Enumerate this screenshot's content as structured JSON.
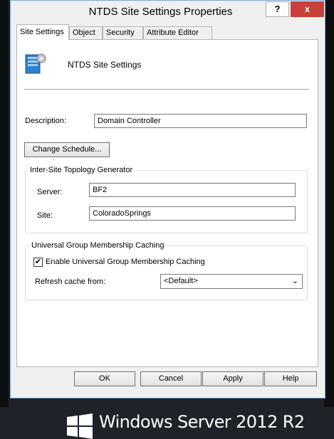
{
  "window": {
    "title": "NTDS Site Settings Properties",
    "help_glyph": "?",
    "close_glyph": "x"
  },
  "tabs": [
    {
      "label": "Site Settings",
      "active": true
    },
    {
      "label": "Object",
      "active": false
    },
    {
      "label": "Security",
      "active": false
    },
    {
      "label": "Attribute Editor",
      "active": false
    }
  ],
  "panel": {
    "object_name": "NTDS Site Settings",
    "icon": "ntds-site-settings-icon",
    "description_label": "Description:",
    "description_value": "Domain Controller",
    "change_schedule_label": "Change Schedule...",
    "istg": {
      "title": "Inter-Site Topology Generator",
      "server_label": "Server:",
      "server_value": "BF2",
      "site_label": "Site:",
      "site_value": "ColoradoSprings"
    },
    "ugmc": {
      "title": "Universal Group Membership Caching",
      "enable_label": "Enable Universal Group Membership Caching",
      "enable_checked": true,
      "refresh_label": "Refresh cache from:",
      "refresh_value": "<Default>"
    }
  },
  "buttons": {
    "ok": "OK",
    "cancel": "Cancel",
    "apply": "Apply",
    "help": "Help"
  },
  "banner": {
    "text": "Windows Server 2012 R2"
  },
  "colors": {
    "close_button": "#c7413a",
    "window_border": "#7aa6d6",
    "banner_bg": "#1d2329"
  }
}
